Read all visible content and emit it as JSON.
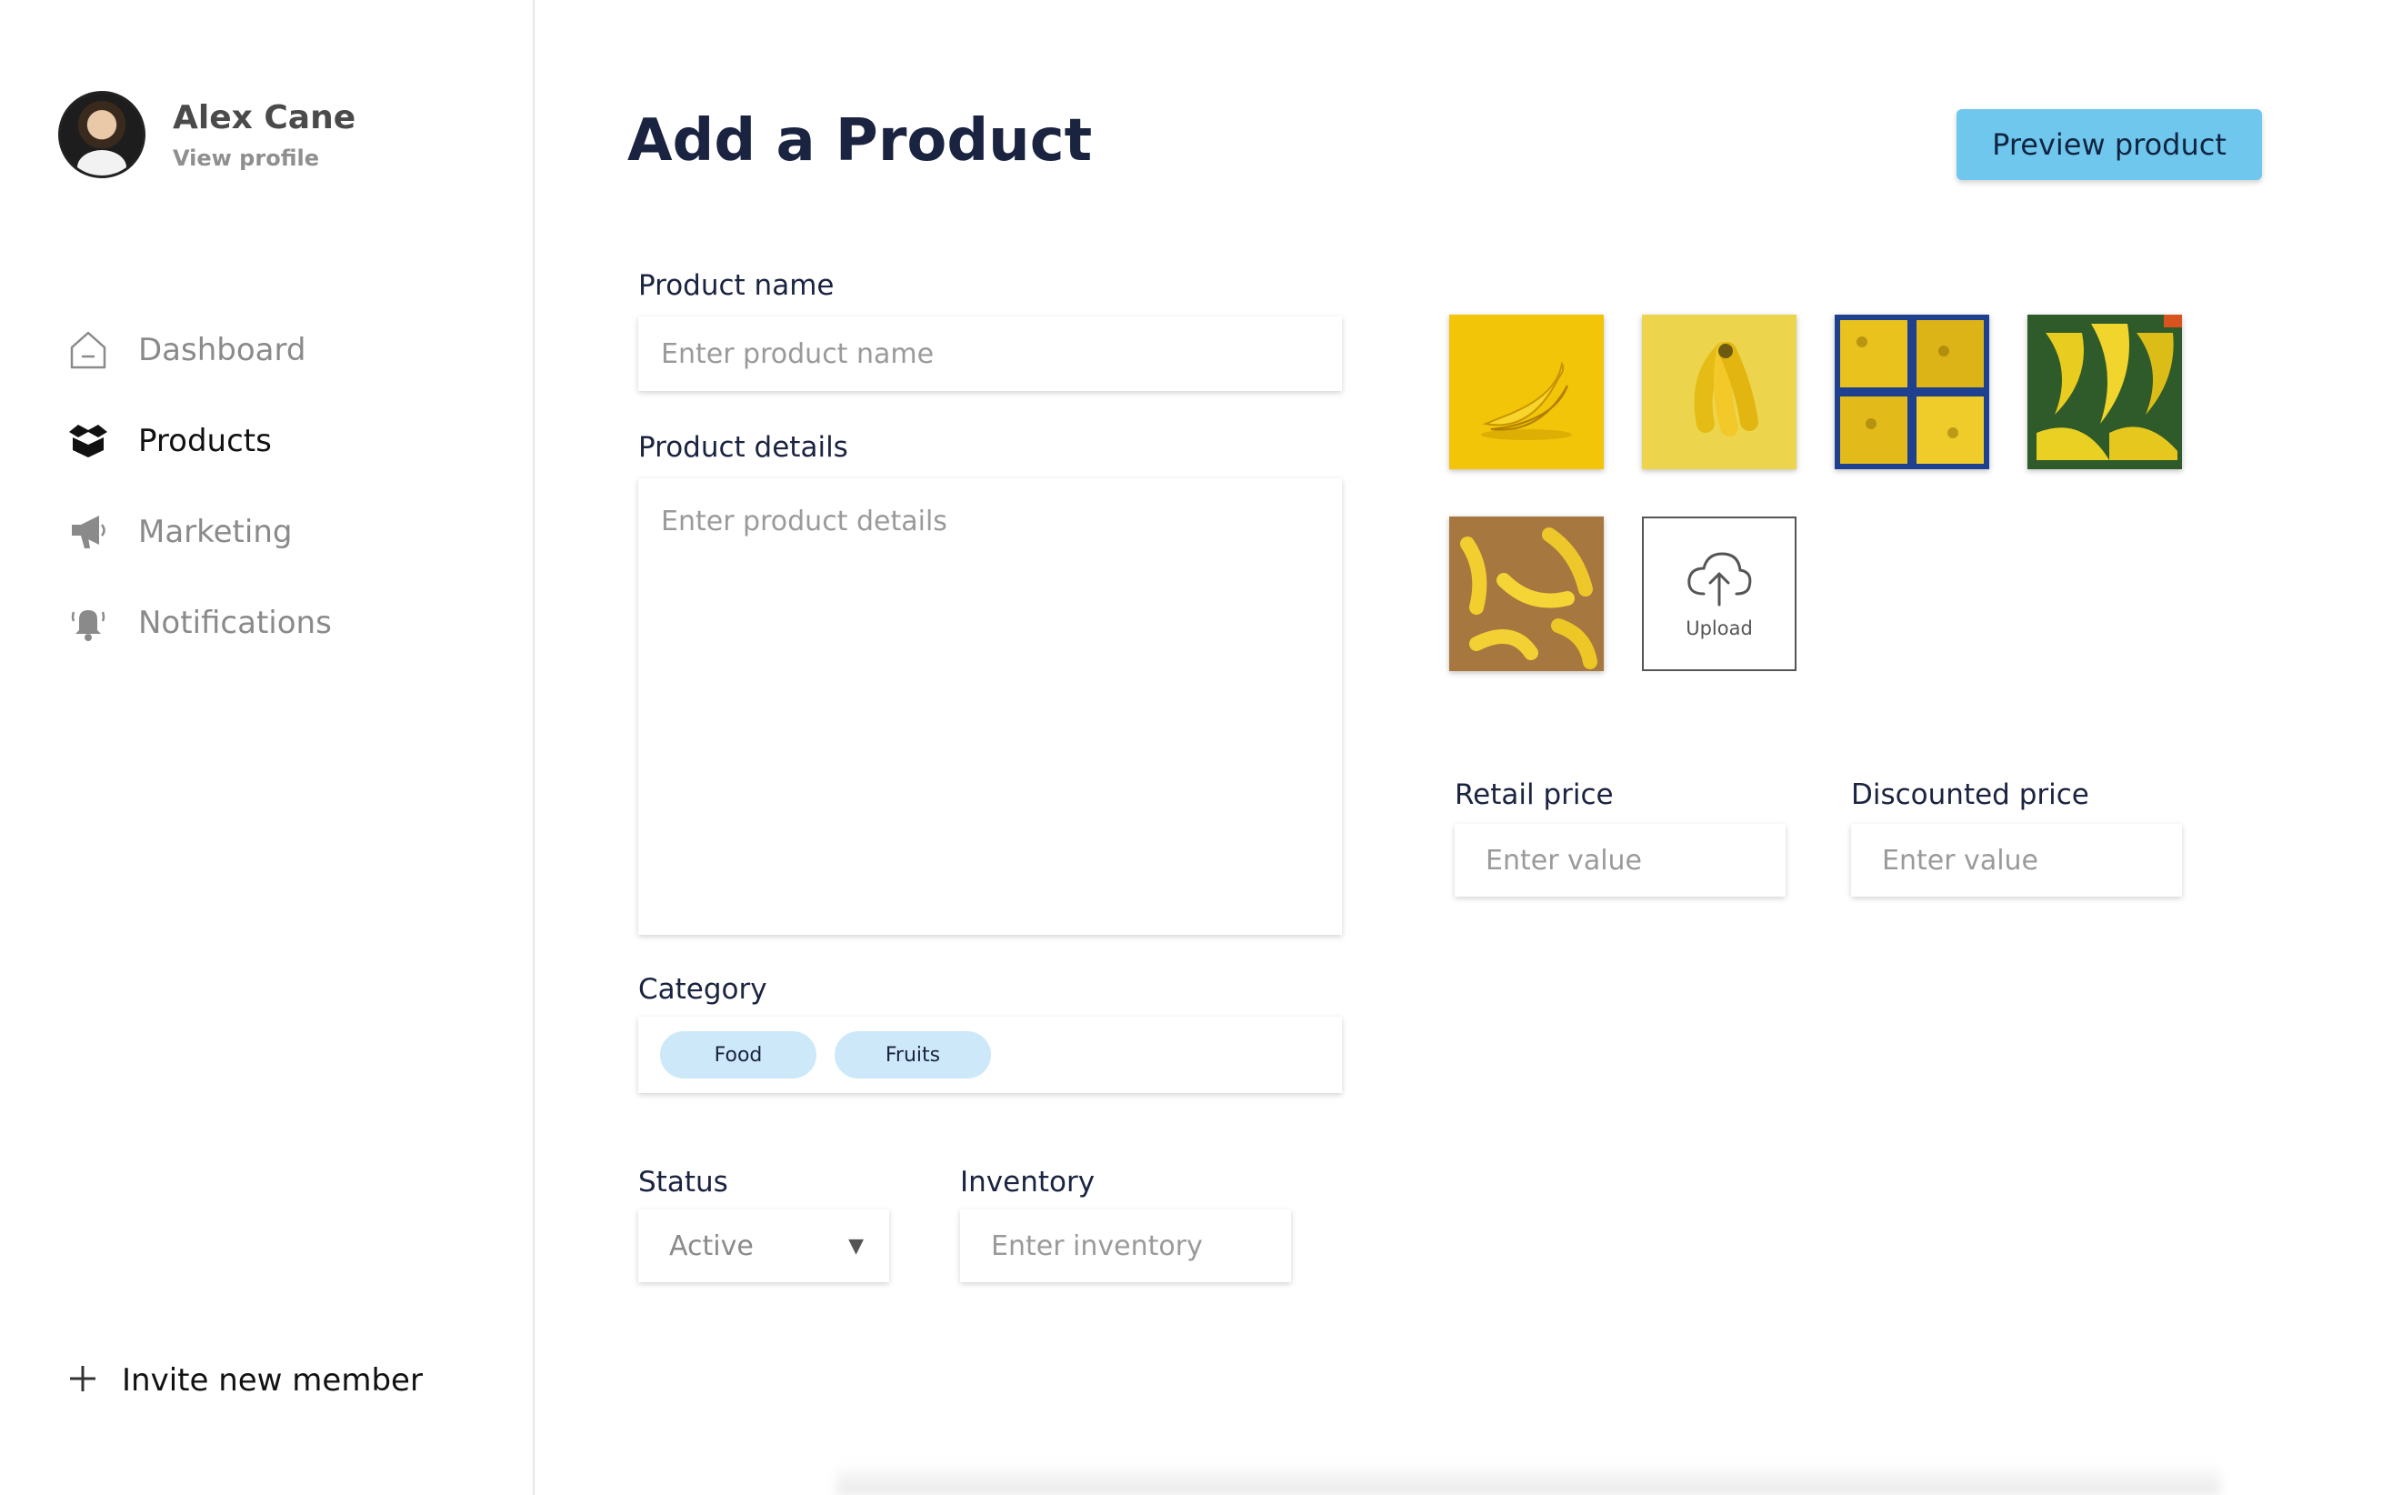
{
  "user": {
    "name": "Alex Cane",
    "profile_link": "View profile"
  },
  "sidebar": {
    "items": [
      {
        "label": "Dashboard",
        "icon": "home-icon",
        "active": false
      },
      {
        "label": "Products",
        "icon": "box-icon",
        "active": true
      },
      {
        "label": "Marketing",
        "icon": "megaphone-icon",
        "active": false
      },
      {
        "label": "Notifications",
        "icon": "bell-icon",
        "active": false
      }
    ],
    "invite_label": "Invite new member"
  },
  "page": {
    "title": "Add a Product",
    "preview_button": "Preview product"
  },
  "form": {
    "product_name": {
      "label": "Product name",
      "placeholder": "Enter product name"
    },
    "product_details": {
      "label": "Product details",
      "placeholder": "Enter product details"
    },
    "category": {
      "label": "Category",
      "tags": [
        "Food",
        "Fruits"
      ]
    },
    "status": {
      "label": "Status",
      "value": "Active"
    },
    "inventory": {
      "label": "Inventory",
      "placeholder": "Enter inventory"
    },
    "retail_price": {
      "label": "Retail price",
      "placeholder": "Enter value"
    },
    "discounted_price": {
      "label": "Discounted price",
      "placeholder": "Enter value"
    }
  },
  "images": {
    "upload_label": "Upload",
    "thumbnails": [
      "banana-yellow-bg",
      "banana-bunch-yellow-bg",
      "banana-crates-blue",
      "banana-market-stall",
      "bananas-brown-bg"
    ]
  },
  "colors": {
    "accent": "#6fc7ee",
    "chip": "#cde8f8",
    "text_dark": "#1a2340"
  }
}
